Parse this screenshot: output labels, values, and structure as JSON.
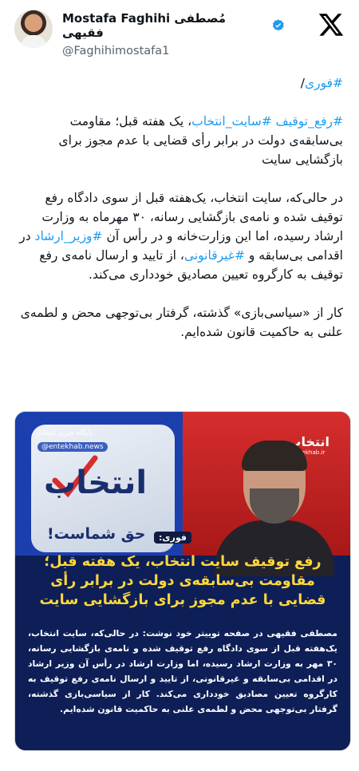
{
  "author": {
    "display_name": "Mostafa Faghihi مُصطفی فقیهی",
    "handle": "@Faghihimostafa1"
  },
  "tweet": {
    "line_urgent_tag": "#فوری",
    "line_urgent_suffix": "/",
    "p1_tag1": "#رفع_توقیف",
    "p1_tag2": "#سایت_انتخاب",
    "p1_text": "، یک هفته قبل؛ مقاومت بی‌سابقه‌ی دولت در برابر رأی قضایی با عدم مجوز برای بازگشایی سایت",
    "p2_text_a": "در حالی‌که، سایت انتخاب، یک‌هفته قبل از سوی دادگاه رفع توقیف شده و نامه‌ی بازگشایی رسانه، ۳۰ مهرماه به وزارت ارشاد رسیده، اما این وزارت‌خانه و در رأس آن ",
    "p2_tag1": "#وزیر_ارشاد",
    "p2_text_b": " در اقدامی بی‌سابقه و ",
    "p2_tag2": "#غیرقانونی",
    "p2_text_c": "، از تایید و ارسال نامه‌ی رفع توقیف به کارگروه تعیین مصادیق خودداری می‌کند.",
    "p3_text": "کار از «سیاسی‌بازی» گذشته، گرفتار بی‌توجهی محض و لطمه‌ی علنی به حاکمیت قانون شده‌ایم."
  },
  "media": {
    "logo_caption": "پایگاه خبری انتخاب",
    "logo_site": "@entekhab.news",
    "logo_word": "انتخاب",
    "tagline": "حق شماست!",
    "brand_small": "انتخاب",
    "brand_small_site": "Entekhab.ir",
    "breaking_label": "فوری:",
    "headline": "رفع توقیف سایت انتخاب، یک هفته قبل؛ مقاومت بی‌سابقه‌ی دولت در برابر رأی قضایی با عدم مجوز برای بازگشایی سایت",
    "body": "مصطفی فقیهی در صفحه توییتر خود نوشت: در حالی‌که، سایت انتخاب، یک‌هفته قبل از سوی دادگاه رفع توقیف شده و نامه‌ی بازگشایی رسانه، ۳۰ مهر به وزارت ارشاد رسیده، اما وزارت ارشاد در رأس آن وزیر ارشاد در اقدامی بی‌سابقه و غیرقانونی، از تایید و ارسال نامه‌ی رفع توقیف به کارگروه تعیین مصادیق خودداری می‌کند. کار از سیاسی‌بازی گذشته، گرفتار بی‌توجهی محض و لطمه‌ی علنی به حاکمیت قانون شده‌ایم."
  },
  "colors": {
    "link": "#1d9bf0",
    "verified": "#1d9bf0",
    "headline": "#ffd83a"
  },
  "icons": {
    "verified": "verified-badge-icon",
    "platform": "x-logo-icon"
  }
}
